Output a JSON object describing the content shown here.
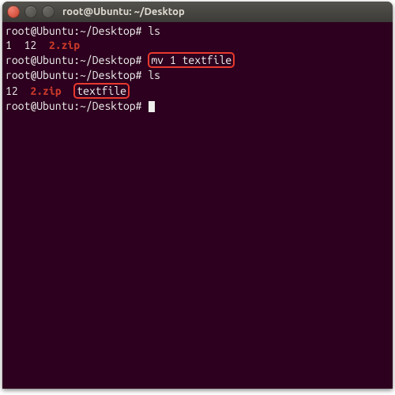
{
  "window": {
    "title": "root@Ubuntu: ~/Desktop",
    "buttons": {
      "close": "close-icon",
      "min": "minimize-icon",
      "max": "maximize-icon"
    }
  },
  "terminal": {
    "prompt": "root@Ubuntu:~/Desktop#",
    "lines": {
      "cmd1": "ls",
      "out1_a": "1  12  ",
      "out1_b": "2.zip",
      "cmd2": "mv 1 textfile",
      "cmd3": "ls",
      "out2_a": "12  ",
      "out2_b": "2.zip",
      "out2_c": "  ",
      "out2_d": "textfile"
    }
  },
  "colors": {
    "bg": "#2c001e",
    "text": "#eeeeec",
    "archive": "#cc3a2a",
    "highlight_border": "#e8392f"
  }
}
